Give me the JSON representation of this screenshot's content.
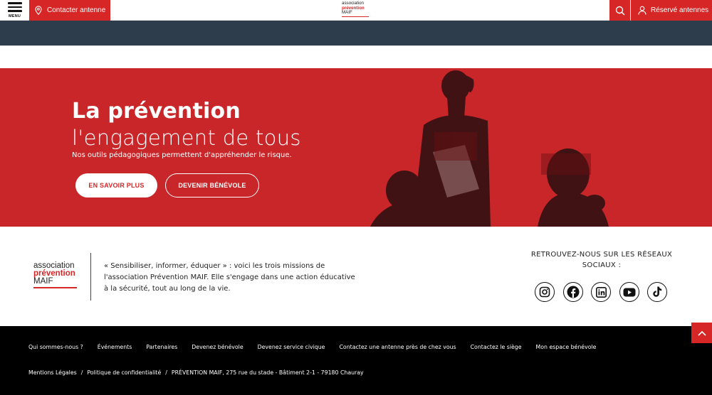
{
  "header": {
    "menu_label": "MENU",
    "contact_label": "Contacter antenne",
    "logo": {
      "line1": "association",
      "line2": "prévention",
      "line3": "MAIF"
    },
    "reserve_label": "Réservé antennes"
  },
  "hero": {
    "title": "La prévention",
    "subtitle": "l'engagement de tous",
    "description": "Nos outils pédagogiques permettent d'appréhender le risque.",
    "btn_primary": "EN SAVOIR PLUS",
    "btn_secondary": "DEVENIR BÉNÉVOLE"
  },
  "info": {
    "logo": {
      "line1": "association",
      "line2": "prévention",
      "line3": "MAIF"
    },
    "mission_lines": [
      "« Sensibiliser, informer, éduquer » : voici les trois missions de",
      "l'association Prévention MAIF. Elle s'engage dans une action éducative",
      "à la sécurité, tout au long de la vie."
    ],
    "social_title_lines": [
      "RETROUVEZ-NOUS SUR LES RÉSEAUX",
      "SOCIAUX :"
    ],
    "social_icons": [
      "instagram-icon",
      "facebook-icon",
      "linkedin-icon",
      "youtube-icon",
      "tiktok-icon"
    ]
  },
  "footer": {
    "nav": [
      "Qui sommes-nous ?",
      "Événements",
      "Partenaires",
      "Devenez bénévole",
      "Devenez service civique",
      "Contactez une antenne près de chez vous",
      "Contactez le siège",
      "Mon espace bénévole"
    ],
    "legal": {
      "mentions": "Mentions Légales",
      "privacy": "Politique de confidentialité",
      "address": "PRÉVENTION MAIF, 275 rue du stade - Bâtiment 2-1 - 79180 Chauray",
      "separator": "/"
    }
  },
  "colors": {
    "brand_red": "#d62626",
    "hero_red": "#c9262a",
    "dark_band": "#2e3d4c",
    "footer_bg": "#000000"
  }
}
